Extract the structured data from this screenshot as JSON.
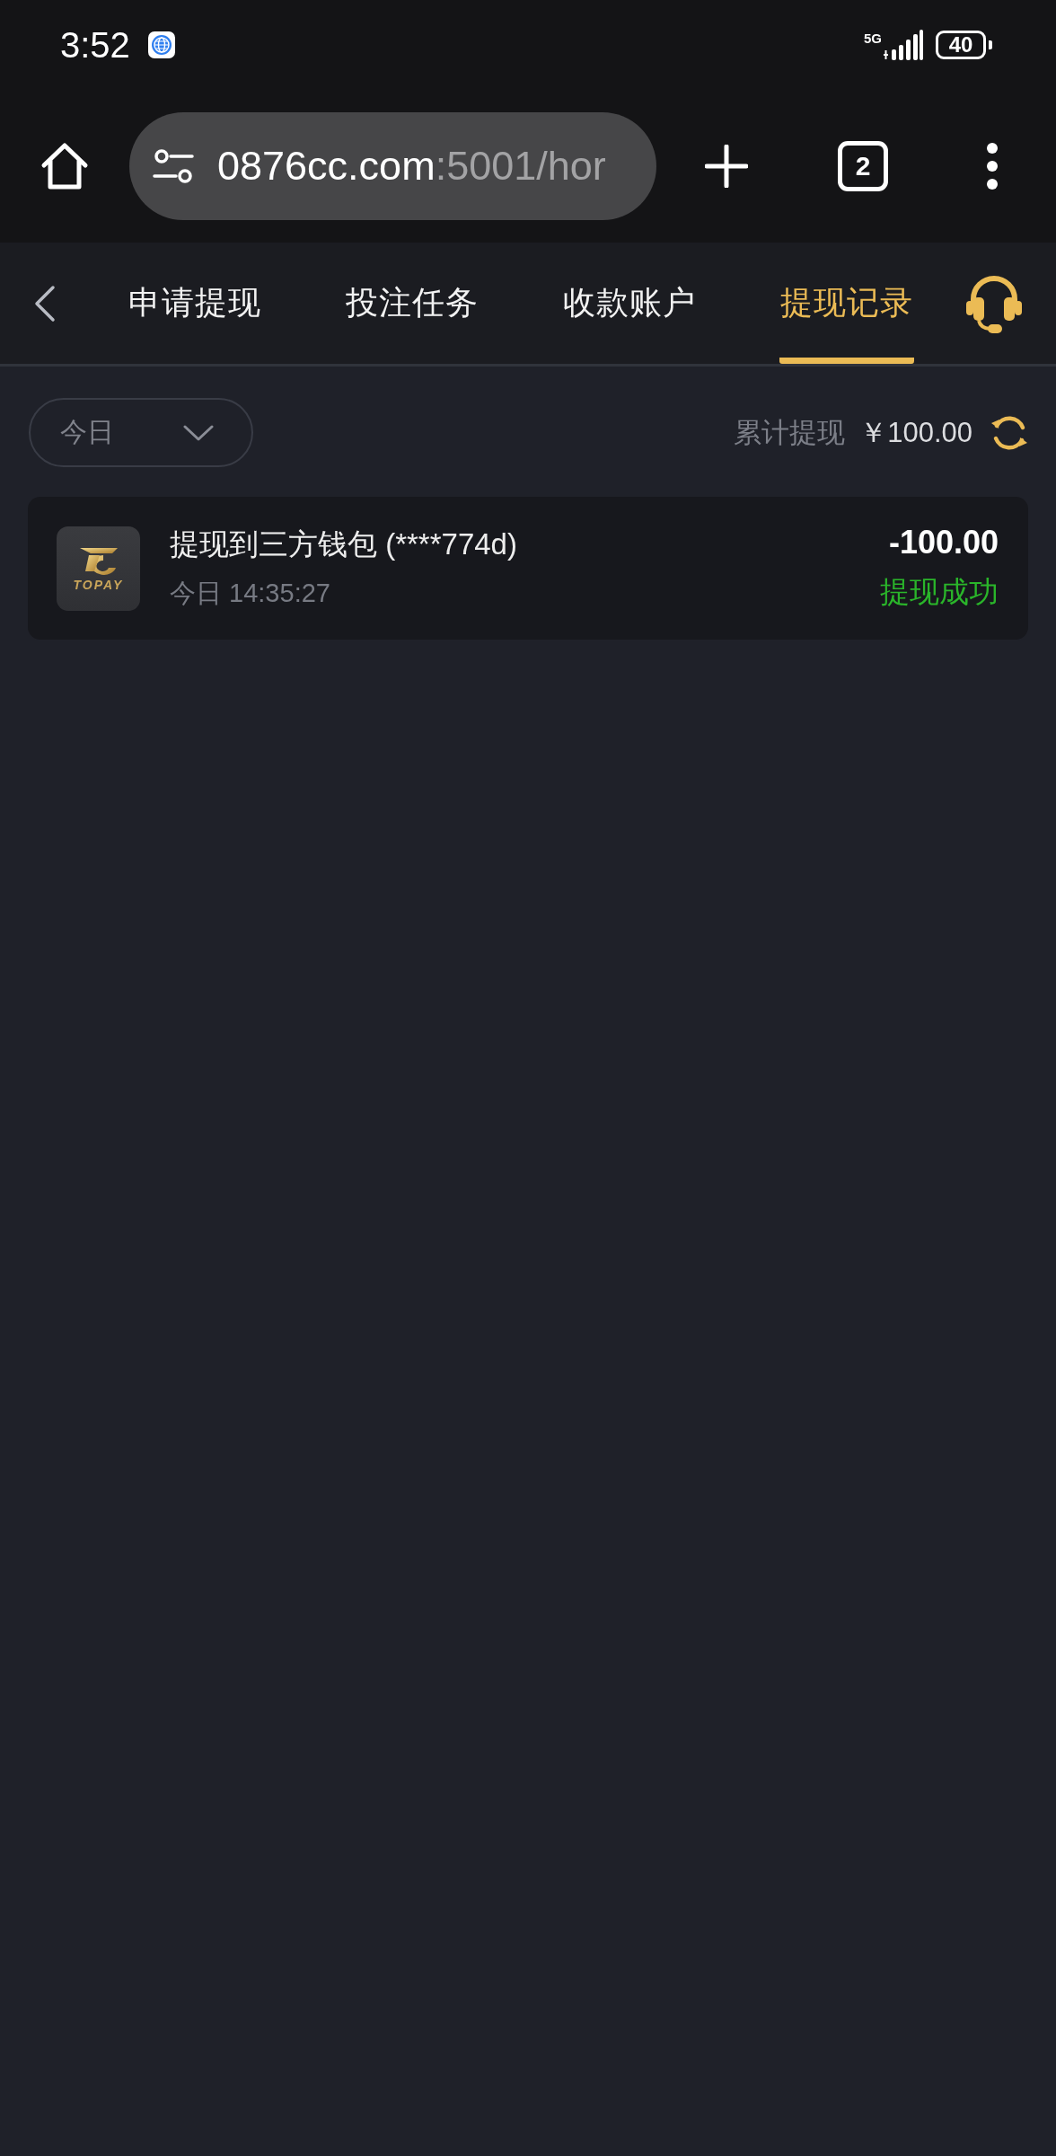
{
  "status_bar": {
    "time": "3:52",
    "network": "5G",
    "battery": "40"
  },
  "browser": {
    "url_host": "0876cc.com",
    "url_rest": ":5001/hor",
    "tab_count": "2"
  },
  "nav": {
    "tabs": [
      {
        "label": "申请提现",
        "selected": false
      },
      {
        "label": "投注任务",
        "selected": false
      },
      {
        "label": "收款账户",
        "selected": false
      },
      {
        "label": "提现记录",
        "selected": true
      }
    ]
  },
  "filter": {
    "period": "今日",
    "total_label": "累计提现",
    "total_amount": "￥100.00"
  },
  "records": [
    {
      "kind": "success",
      "logo_text": "TOPAY",
      "title": "提现到三方钱包 (****774d)",
      "time": "今日 14:35:27",
      "amount": "-100.00",
      "status": "提现成功"
    }
  ]
}
